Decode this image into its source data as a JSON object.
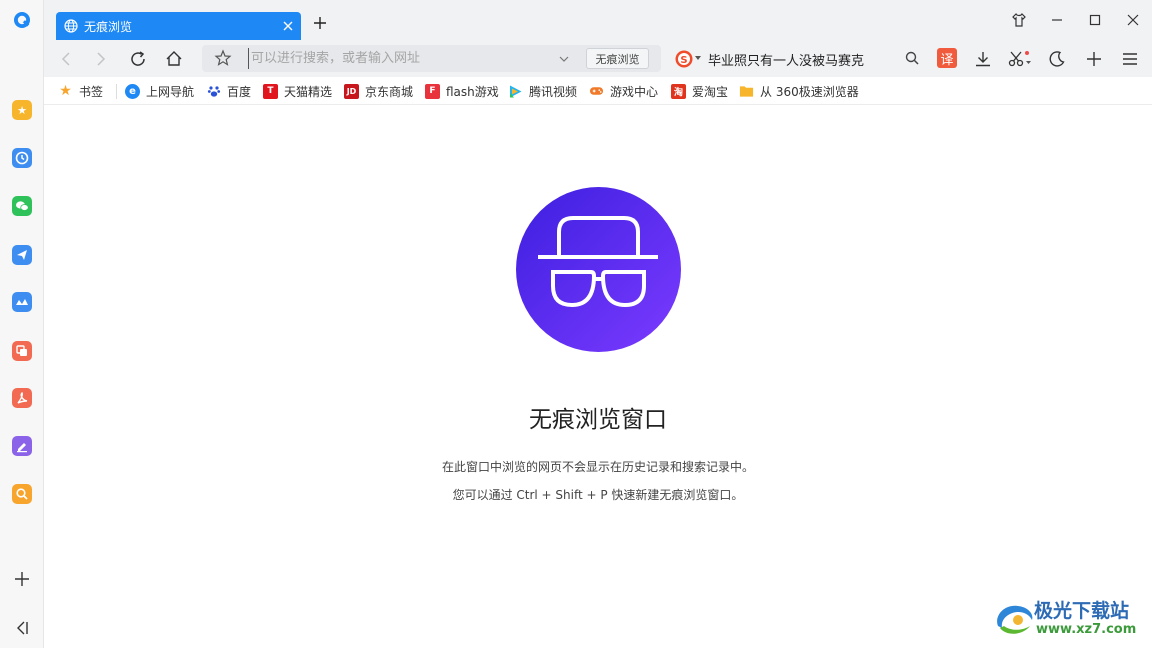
{
  "tab": {
    "title": "无痕浏览",
    "close_icon": "close-icon",
    "globe_icon": "globe-icon"
  },
  "toolbar": {
    "address_placeholder": "可以进行搜索，或者输入网址",
    "incognito_label": "无痕浏览",
    "search_query": "毕业照只有一人没被马赛克",
    "translate_label": "译"
  },
  "bookmarks": [
    {
      "label": "书签",
      "icon": "star-icon"
    },
    {
      "label": "上网导航",
      "icon": "e-icon"
    },
    {
      "label": "百度",
      "icon": "baidu-paw-icon"
    },
    {
      "label": "天猫精选",
      "icon": "tmall-icon",
      "glyph": "T"
    },
    {
      "label": "京东商城",
      "icon": "jd-icon",
      "glyph": "JD"
    },
    {
      "label": "flash游戏",
      "icon": "flash-game-icon",
      "glyph": "F"
    },
    {
      "label": "腾讯视频",
      "icon": "tencent-video-icon"
    },
    {
      "label": "游戏中心",
      "icon": "gamepad-icon"
    },
    {
      "label": "爱淘宝",
      "icon": "taobao-icon",
      "glyph": "淘"
    },
    {
      "label": "从 360极速浏览器",
      "icon": "folder-icon"
    }
  ],
  "main": {
    "title": "无痕浏览窗口",
    "desc1": "在此窗口中浏览的网页不会显示在历史记录和搜索记录中。",
    "desc2": "您可以通过 Ctrl + Shift + P 快速新建无痕浏览窗口。"
  },
  "watermark": {
    "title": "极光下载站",
    "url": "www.xz7.com"
  },
  "colors": {
    "accent": "#1e88f5",
    "hero_start": "#3d1fe0",
    "hero_end": "#7b3bff"
  }
}
